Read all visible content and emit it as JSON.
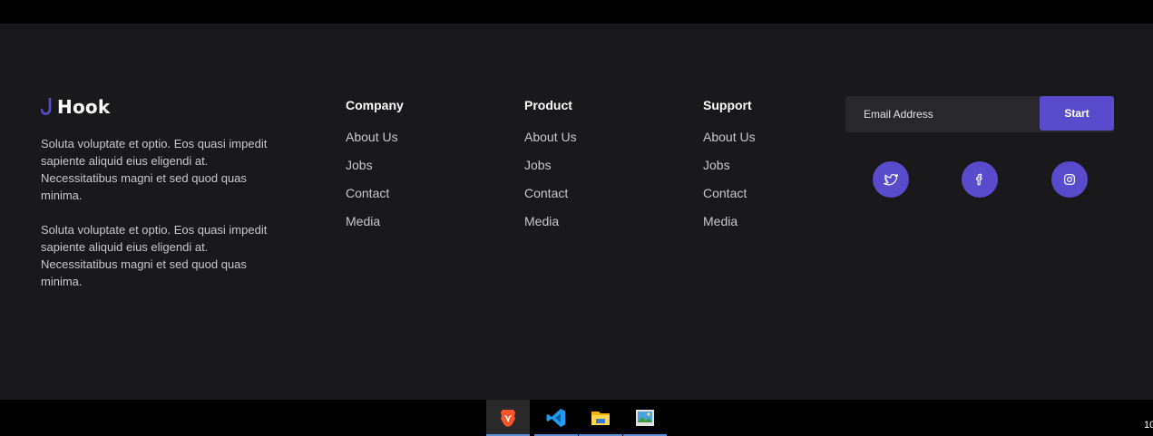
{
  "brand": {
    "name": "Hook",
    "icon": "hook-logo-icon",
    "accent": "#5a4bcc"
  },
  "about": {
    "paragraphs": [
      "Soluta voluptate et optio. Eos quasi impedit sapiente aliquid eius eligendi at. Necessitatibus magni et sed quod quas minima.",
      "Soluta voluptate et optio. Eos quasi impedit sapiente aliquid eius eligendi at. Necessitatibus magni et sed quod quas minima."
    ]
  },
  "columns": [
    {
      "title": "Company",
      "links": [
        "About Us",
        "Jobs",
        "Contact",
        "Media"
      ]
    },
    {
      "title": "Product",
      "links": [
        "About Us",
        "Jobs",
        "Contact",
        "Media"
      ]
    },
    {
      "title": "Support",
      "links": [
        "About Us",
        "Jobs",
        "Contact",
        "Media"
      ]
    }
  ],
  "newsletter": {
    "placeholder": "Email Address",
    "button_label": "Start"
  },
  "social": [
    {
      "icon": "twitter-icon"
    },
    {
      "icon": "facebook-icon"
    },
    {
      "icon": "instagram-icon"
    }
  ],
  "taskbar": {
    "apps": [
      {
        "icon": "brave-browser-icon",
        "active": true
      },
      {
        "icon": "vscode-icon",
        "active": false
      },
      {
        "icon": "file-explorer-icon",
        "active": false
      },
      {
        "icon": "photos-icon",
        "active": false
      }
    ],
    "tray_text": "10"
  },
  "colors": {
    "footer_bg": "#19191b",
    "accent": "#5a4bcc",
    "input_bg": "#28272c"
  }
}
